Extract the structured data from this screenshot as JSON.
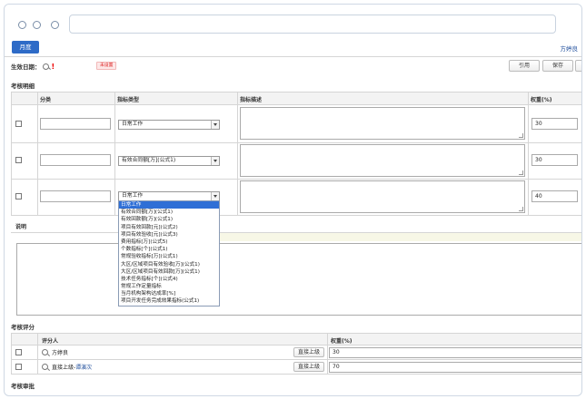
{
  "header": {
    "month_tab": "月度",
    "user_name": "方婷良"
  },
  "effective": {
    "label": "生效日期：",
    "required_mark": "!",
    "badge": "未设置"
  },
  "toolbar": {
    "cite": "引用",
    "save": "保存"
  },
  "assessment": {
    "title": "考核明细",
    "columns": {
      "category": "分类",
      "indicator_type": "指标类型",
      "indicator_desc": "指标描述",
      "weight": "权重(%)"
    },
    "rows": [
      {
        "category": "",
        "type": "日常工作",
        "desc": "",
        "weight": "30"
      },
      {
        "category": "",
        "type": "有效合同额[万](公式1)",
        "desc": "",
        "weight": "30"
      },
      {
        "category": "",
        "type": "日常工作",
        "desc": "",
        "weight": "40"
      }
    ],
    "notes_label": "说明"
  },
  "dropdown": {
    "options": [
      "日常工作",
      "有效合同额[万](公式1)",
      "有效回款额[万](公式1)",
      "项目有效回款[元](公式2)",
      "项目有效验收[元](公式3)",
      "费用指标[万](公式5)",
      "个数指标[个](公式1)",
      "常规验收指标[万](公式1)",
      "大区/区域项目有效验收[万](公式1)",
      "大区/区域项目有效回款[万](公式1)",
      "技术任务指标[个](公式4)",
      "常规工作定量指标",
      "当月机构架构达成率[%]",
      "项目开发任务完成效果指标(公式1)"
    ],
    "selected_index": 0
  },
  "evaluation": {
    "title": "考核评分",
    "columns": {
      "evaluator": "评分人",
      "weight": "权重(%)"
    },
    "rows": [
      {
        "name": "方婷良",
        "prefix": "",
        "button": "直接上级",
        "weight": "30"
      },
      {
        "name": "谭演次",
        "prefix": "直接上级-",
        "button": "直接上级",
        "weight": "70"
      }
    ]
  },
  "approval": {
    "title": "考核审批"
  }
}
